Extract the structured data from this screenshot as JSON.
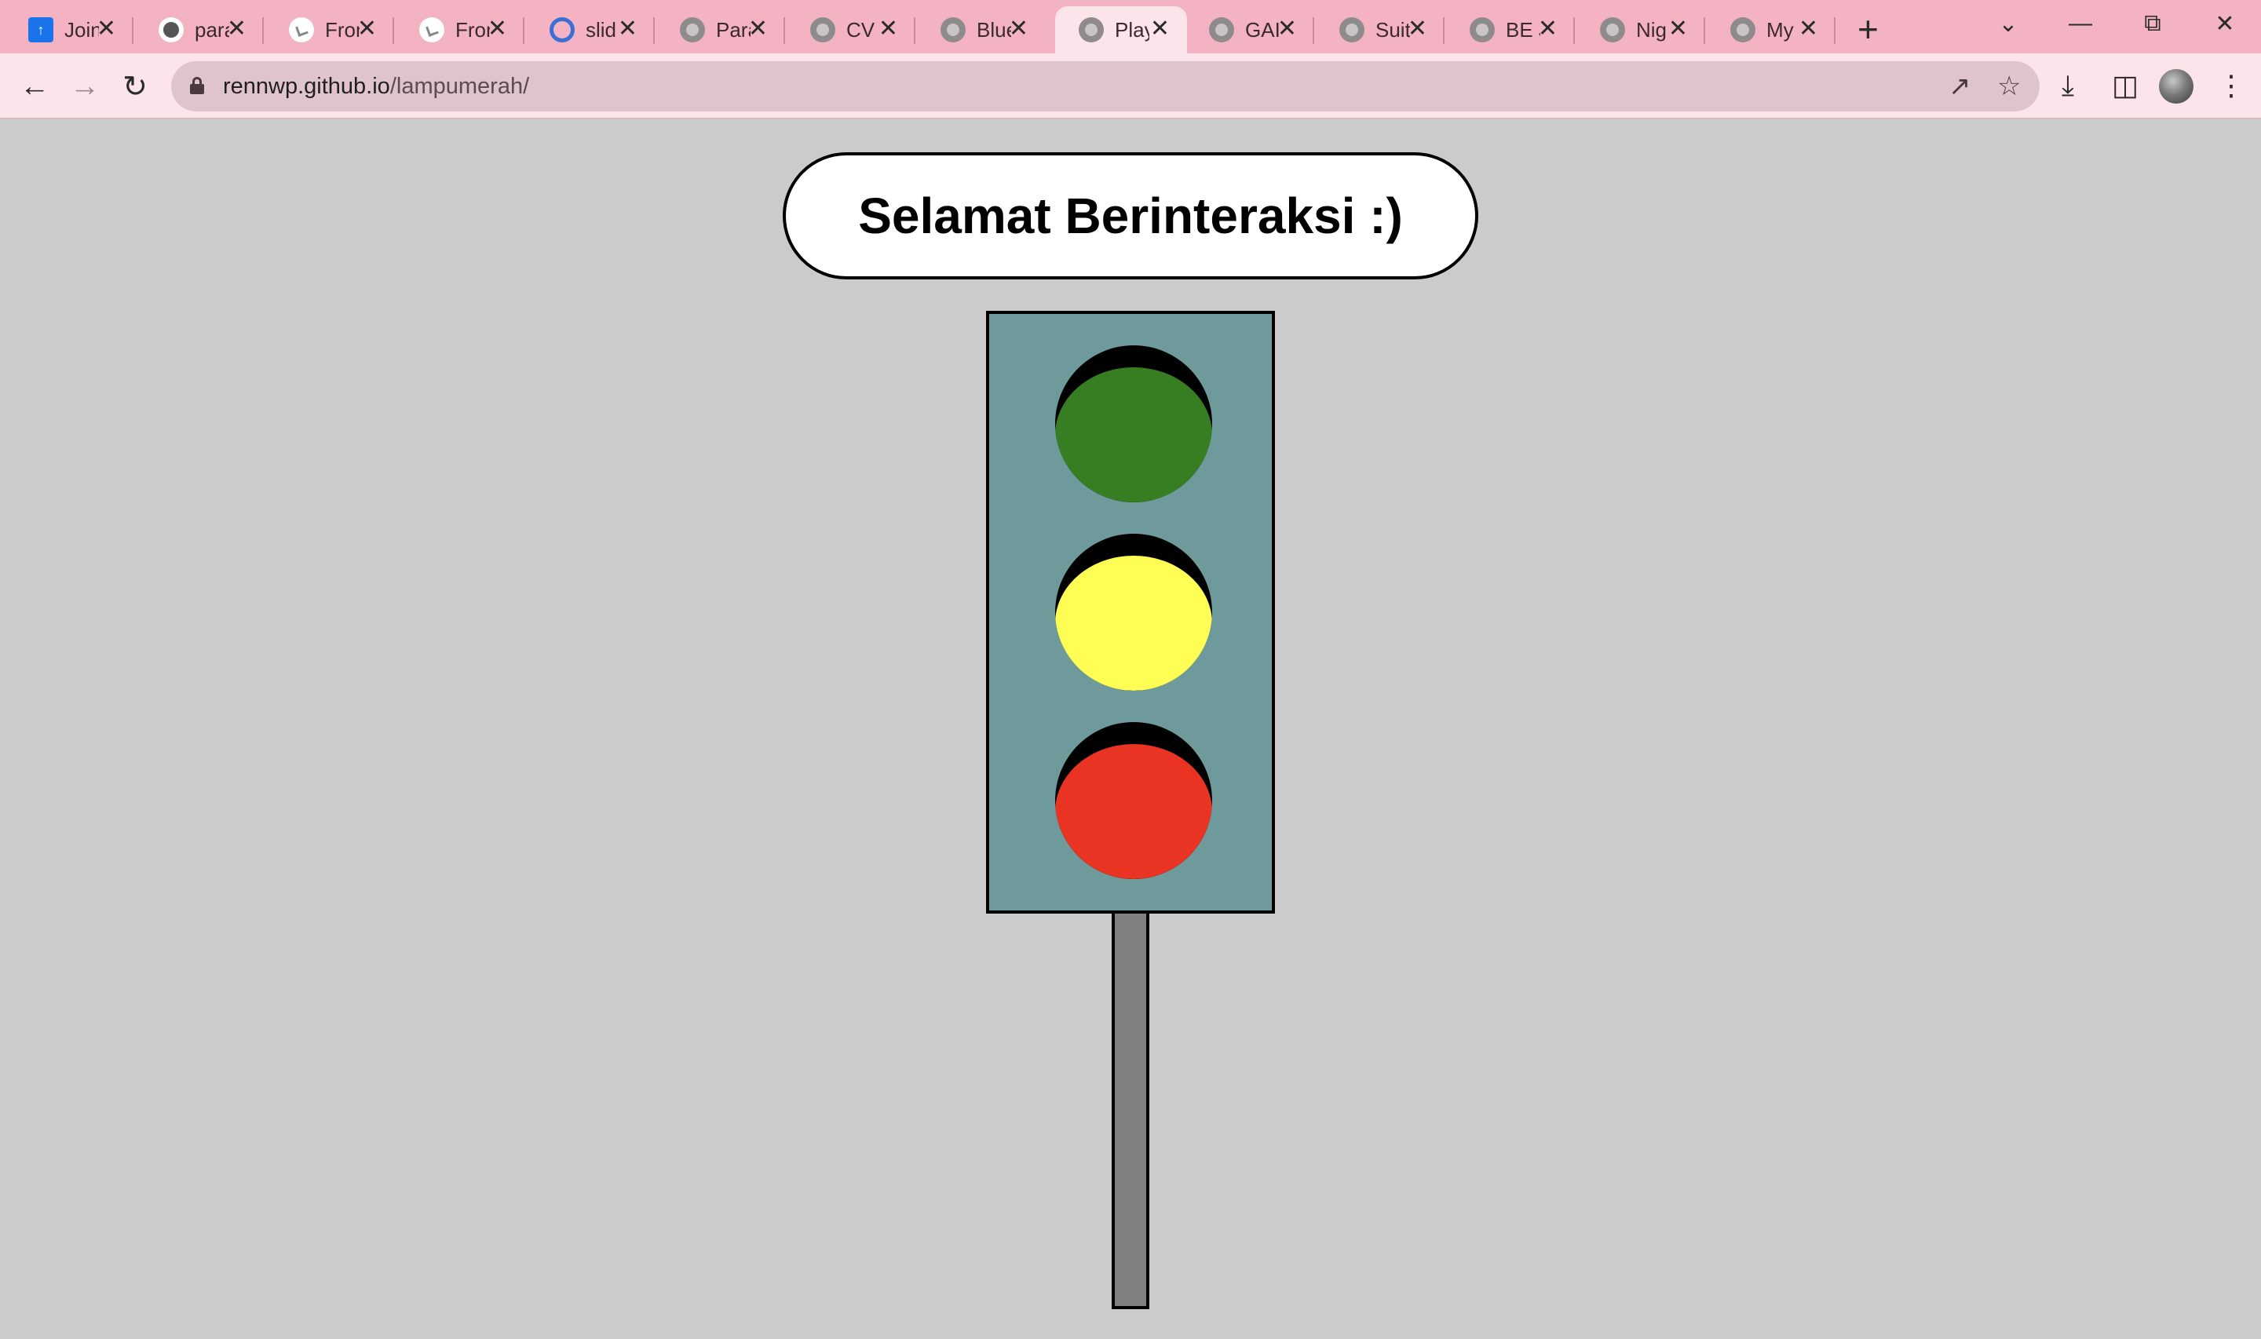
{
  "browser": {
    "tabs": [
      {
        "title": "Join",
        "favicon": "app-icon"
      },
      {
        "title": "para",
        "favicon": "github-icon"
      },
      {
        "title": "Fron",
        "favicon": "site-icon"
      },
      {
        "title": "Fron",
        "favicon": "site-icon"
      },
      {
        "title": "slid",
        "favicon": "ring-icon"
      },
      {
        "title": "Para",
        "favicon": "globe-icon"
      },
      {
        "title": "CV",
        "favicon": "globe-icon"
      },
      {
        "title": "Blue",
        "favicon": "globe-icon"
      },
      {
        "title": "Play",
        "favicon": "globe-icon",
        "active": true
      },
      {
        "title": "GAI",
        "favicon": "globe-icon"
      },
      {
        "title": "Suit",
        "favicon": "globe-icon"
      },
      {
        "title": "BE J",
        "favicon": "globe-icon"
      },
      {
        "title": "Nig",
        "favicon": "globe-icon"
      },
      {
        "title": "My",
        "favicon": "globe-icon"
      }
    ],
    "address": {
      "domain": "rennwp.github.io",
      "path": "/lampumerah/"
    },
    "colors": {
      "tabbar": "#f4b3c2",
      "toolbar": "#fbe4ea",
      "omnibox": "#dfc5cb"
    }
  },
  "page": {
    "greeting": "Selamat Berinteraksi :)",
    "background": "#cbcbcb",
    "traffic_light": {
      "housing_color": "#6e9a9c",
      "pole_color": "#808080",
      "lamps": [
        {
          "name": "green",
          "color": "#377e22"
        },
        {
          "name": "yellow",
          "color": "#fffe54"
        },
        {
          "name": "red",
          "color": "#e93323"
        }
      ]
    }
  }
}
